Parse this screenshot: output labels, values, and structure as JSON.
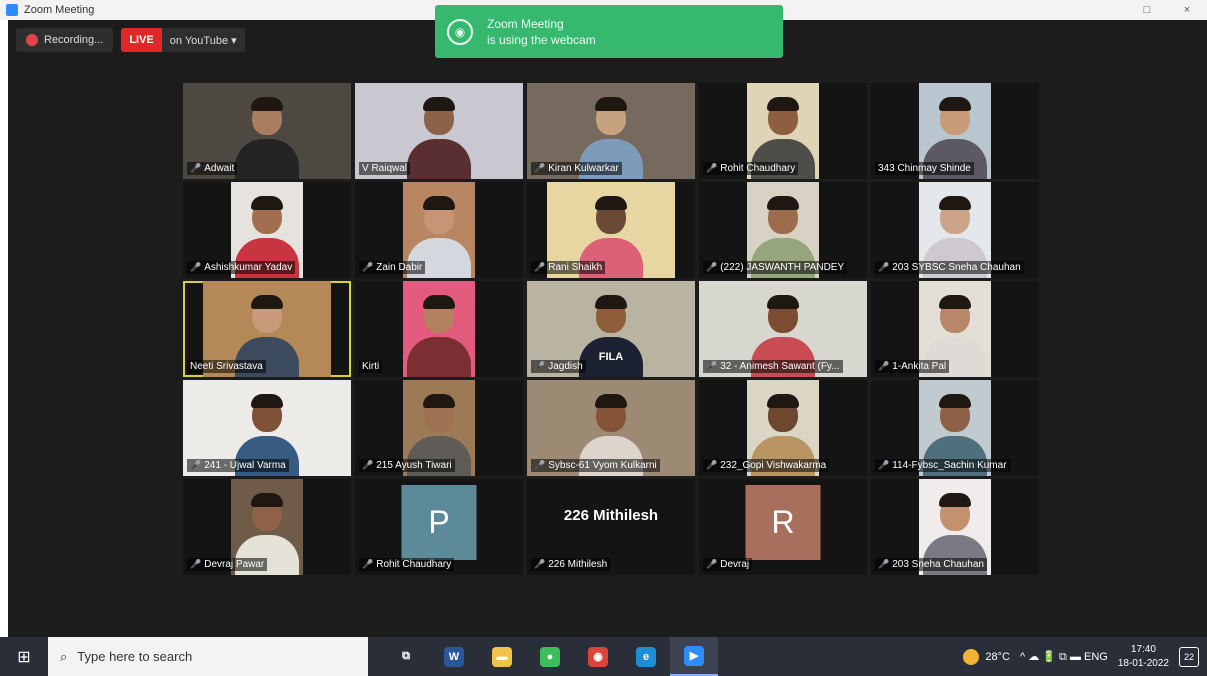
{
  "window": {
    "title": "Zoom Meeting",
    "controls": [
      "□",
      "×"
    ]
  },
  "recording": {
    "label": "Recording..."
  },
  "live": {
    "badge": "LIVE",
    "target": "on YouTube ▾"
  },
  "notification": {
    "line1": "Zoom Meeting",
    "line2": "is using the webcam"
  },
  "participants": [
    {
      "name": "Adwait",
      "muted": true,
      "kind": "video",
      "bg": "#4e4843",
      "skin": "#a97e60",
      "shirt": "#242424",
      "vw": 168
    },
    {
      "name": "V Raiqwal",
      "muted": false,
      "kind": "video",
      "bg": "#c9c7cf",
      "skin": "#8b6148",
      "shirt": "#5a2f32",
      "vw": 168
    },
    {
      "name": "Kiran Kulwarkar",
      "muted": true,
      "kind": "video",
      "bg": "#766a5e",
      "skin": "#c7a27f",
      "shirt": "#7d9cbc",
      "vw": 168
    },
    {
      "name": "Rohit Chaudhary",
      "muted": true,
      "kind": "video",
      "bg": "#e0d4b7",
      "skin": "#8d5e40",
      "shirt": "#4d4d49",
      "vw": 72
    },
    {
      "name": "343 Chinmay Shinde",
      "muted": false,
      "kind": "video",
      "bg": "#b9c5cf",
      "skin": "#c89a78",
      "shirt": "#5d5963",
      "vw": 72
    },
    {
      "name": "Ashishkumar Yadav",
      "muted": true,
      "kind": "video",
      "bg": "#e6e3df",
      "skin": "#a16f50",
      "shirt": "#c8343f",
      "vw": 72
    },
    {
      "name": "Zain Dabir",
      "muted": true,
      "kind": "video",
      "bg": "#b88660",
      "skin": "#c79576",
      "shirt": "#d4d7de",
      "vw": 72
    },
    {
      "name": "Rani Shaikh",
      "muted": true,
      "kind": "video",
      "bg": "#e8d6a2",
      "skin": "#6a4a35",
      "shirt": "#dd6176",
      "vw": 128
    },
    {
      "name": "(222) JASWANTH PANDEY",
      "muted": true,
      "kind": "video",
      "bg": "#d8d2c4",
      "skin": "#9c6c4d",
      "shirt": "#97a57c",
      "vw": 72
    },
    {
      "name": "203 SYBSC Sneha Chauhan",
      "muted": true,
      "kind": "video",
      "bg": "#e4e7ec",
      "skin": "#caa389",
      "shirt": "#cdc9ce",
      "vw": 72
    },
    {
      "name": "Neeti Srivastava",
      "muted": false,
      "kind": "video",
      "bg": "#b58857",
      "skin": "#c99a7a",
      "shirt": "#3c4b5e",
      "vw": 128,
      "active": true
    },
    {
      "name": "Kirti",
      "muted": false,
      "kind": "video",
      "bg": "#e25a7d",
      "skin": "#b3835f",
      "shirt": "#7b2f33",
      "vw": 72
    },
    {
      "name": "Jagdish",
      "muted": true,
      "kind": "video",
      "bg": "#b9b4a2",
      "skin": "#8e5e3b",
      "shirt": "#1c2232",
      "vw": 168,
      "shirt_text": "FILA"
    },
    {
      "name": "32 - Animesh Sawant (Fy...",
      "muted": true,
      "kind": "video",
      "bg": "#d8d7cf",
      "skin": "#7d4d33",
      "shirt": "#c94c54",
      "vw": 168
    },
    {
      "name": "1-Ankita Pal",
      "muted": true,
      "kind": "video",
      "bg": "#e3dfd7",
      "skin": "#b8876a",
      "shirt": "#e0dad6",
      "vw": 72
    },
    {
      "name": "241 - Ujwal Varma",
      "muted": true,
      "kind": "video",
      "bg": "#ecebe7",
      "skin": "#7f5138",
      "shirt": "#385b82",
      "vw": 168
    },
    {
      "name": "215 Ayush Tiwari",
      "muted": true,
      "kind": "video",
      "bg": "#9c7a56",
      "skin": "#9d7151",
      "shirt": "#5f5b56",
      "vw": 72
    },
    {
      "name": "Sybsc-61 Vyom Kulkarni",
      "muted": true,
      "kind": "video",
      "bg": "#9d8a75",
      "skin": "#855436",
      "shirt": "#ddd5cc",
      "vw": 168
    },
    {
      "name": "232_Gopi Vishwakarma",
      "muted": true,
      "kind": "video",
      "bg": "#dad5c5",
      "skin": "#6e4730",
      "shirt": "#b89562",
      "vw": 72
    },
    {
      "name": "114-Fybsc_Sachin Kumar",
      "muted": true,
      "kind": "video",
      "bg": "#c1cace",
      "skin": "#8f6046",
      "shirt": "#4f6f7d",
      "vw": 72
    },
    {
      "name": "Devraj Pawar",
      "muted": true,
      "kind": "video",
      "bg": "#6f5b48",
      "skin": "#8f6149",
      "shirt": "#e4e2d6",
      "vw": 72
    },
    {
      "name": "Rohit Chaudhary",
      "muted": true,
      "kind": "avatar",
      "letter": "P",
      "color": "#5d8a98"
    },
    {
      "name": "226 Mithilesh",
      "muted": true,
      "kind": "text",
      "big": "226 Mithilesh"
    },
    {
      "name": "Devraj",
      "muted": true,
      "kind": "avatar",
      "letter": "R",
      "color": "#a86f5c"
    },
    {
      "name": "203 Sneha Chauhan",
      "muted": true,
      "kind": "video",
      "bg": "#f0ecec",
      "skin": "#c39070",
      "shirt": "#7a7a84",
      "vw": 72
    }
  ],
  "taskbar": {
    "start_icon": "windows-icon",
    "search_placeholder": "Type here to search",
    "apps": [
      {
        "name": "task-view",
        "glyph": "⧉",
        "color": "#2a2e38"
      },
      {
        "name": "word",
        "glyph": "W",
        "color": "#2b579a"
      },
      {
        "name": "file-explorer",
        "glyph": "▬",
        "color": "#f0c24a"
      },
      {
        "name": "wechat",
        "glyph": "●",
        "color": "#3cbf5a"
      },
      {
        "name": "chrome",
        "glyph": "◉",
        "color": "#dc4437"
      },
      {
        "name": "edge",
        "glyph": "e",
        "color": "#1e8ed6"
      },
      {
        "name": "zoom",
        "glyph": "▶",
        "color": "#2d8cff"
      }
    ],
    "weather": "28°C",
    "tray_glyphs": "^ ☁ 🔋 ⧉ ▬ ENG",
    "time": "17:40",
    "date": "18-01-2022",
    "notifications": "22"
  }
}
